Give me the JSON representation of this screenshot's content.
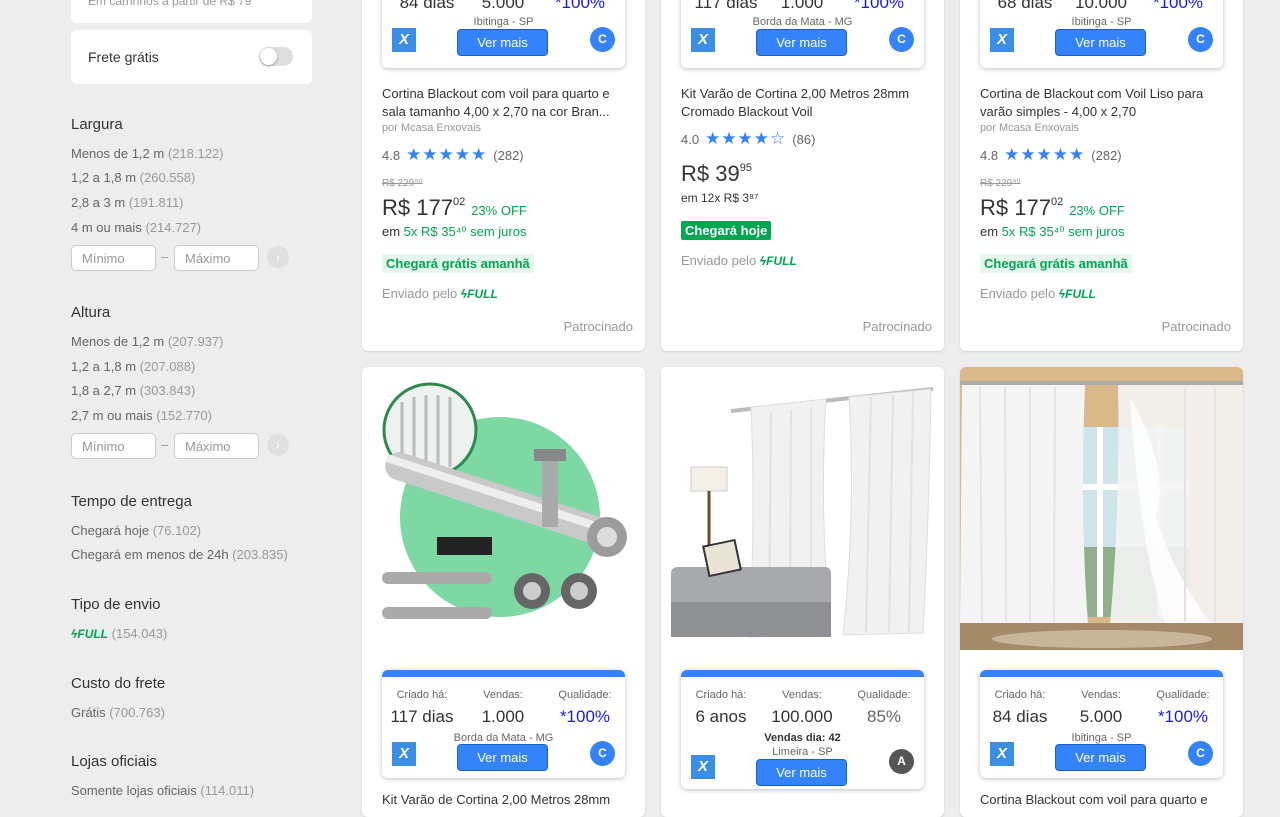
{
  "filters": {
    "shipping_note": "Em carrinhos a partir de R$ 79",
    "free_shipping_label": "Frete grátis",
    "min_placeholder": "Mínimo",
    "max_placeholder": "Máximo",
    "width": {
      "title": "Largura",
      "items": [
        {
          "label": "Menos de 1,2 m",
          "count": "(218.122)"
        },
        {
          "label": "1,2 a 1,8 m",
          "count": "(260.558)"
        },
        {
          "label": "2,8 a 3 m",
          "count": "(191.811)"
        },
        {
          "label": "4 m ou mais",
          "count": "(214.727)"
        }
      ]
    },
    "height": {
      "title": "Altura",
      "items": [
        {
          "label": "Menos de 1,2 m",
          "count": "(207.937)"
        },
        {
          "label": "1,2 a 1,8 m",
          "count": "(207.088)"
        },
        {
          "label": "1,8 a 2,7 m",
          "count": "(303.843)"
        },
        {
          "label": "2,7 m ou mais",
          "count": "(152.770)"
        }
      ]
    },
    "delivery": {
      "title": "Tempo de entrega",
      "items": [
        {
          "label": "Chegará hoje",
          "count": "(76.102)"
        },
        {
          "label": "Chegará em menos de 24h",
          "count": "(203.835)"
        }
      ]
    },
    "shipping_type": {
      "title": "Tipo de envio",
      "full": "FULL",
      "count": "(154.043)"
    },
    "shipping_cost": {
      "title": "Custo do frete",
      "label": "Grátis",
      "count": "(700.763)"
    },
    "official": {
      "title": "Lojas oficiais",
      "label": "Somente lojas oficiais",
      "count": "(114.011)"
    }
  },
  "widget_labels": {
    "created": "Criado há:",
    "sales": "Vendas:",
    "quality": "Qualidade:",
    "more": "Ver mais",
    "logo": "X",
    "sales_day": "Vendas dia: 42"
  },
  "top_cards": [
    {
      "created": "84 dias",
      "sales": "5.000",
      "quality": "*100%",
      "location": "Ibitinga - SP",
      "badge": "C",
      "title": "Cortina Blackout com voil para quarto e sala tamanho 4,00 x 2,70 na cor Bran...",
      "seller": "por Mcasa Enxovais",
      "rating": "4.8",
      "stars": "★★★★★",
      "reviews": "(282)",
      "old_price": "R$ 229⁹⁰",
      "price_int": "R$ 177",
      "price_cents": "02",
      "discount": "23% OFF",
      "inst_prefix": "em ",
      "inst": "5x R$ 35⁴⁰ sem juros",
      "delivery": "Chegará grátis amanhã",
      "sent": "Enviado pelo",
      "full": "FULL",
      "sponsored": "Patrocinado"
    },
    {
      "created": "117 dias",
      "sales": "1.000",
      "quality": "*100%",
      "location": "Borda da Mata - MG",
      "badge": "C",
      "title": "Kit Varão de Cortina 2,00 Metros 28mm Cromado Blackout Voil",
      "seller": "",
      "rating": "4.0",
      "stars": "★★★★☆",
      "reviews": "(86)",
      "price_int": "R$ 39",
      "price_cents": "95",
      "inst": "em 12x R$ 3⁸⁷",
      "delivery": "Chegará hoje",
      "sent": "Enviado pelo",
      "full": "FULL",
      "sponsored": "Patrocinado"
    },
    {
      "created": "68 dias",
      "sales": "10.000",
      "quality": "*100%",
      "location": "Ibitinga - SP",
      "badge": "C",
      "title": "Cortina de Blackout com Voil Liso para varão simples - 4,00 x 2,70",
      "seller": "por Mcasa Enxovais",
      "rating": "4.8",
      "stars": "★★★★★",
      "reviews": "(282)",
      "old_price": "R$ 229⁹⁰",
      "price_int": "R$ 177",
      "price_cents": "02",
      "discount": "23% OFF",
      "inst_prefix": "em ",
      "inst": "5x R$ 35⁴⁰ sem juros",
      "delivery": "Chegará grátis amanhã",
      "sent": "Enviado pelo",
      "full": "FULL",
      "sponsored": "Patrocinado"
    }
  ],
  "bottom_cards": [
    {
      "created": "117 dias",
      "sales": "1.000",
      "quality": "*100%",
      "location": "Borda da Mata - MG",
      "badge": "C",
      "title": "Kit Varão de Cortina 2,00 Metros 28mm"
    },
    {
      "created": "6 anos",
      "sales": "100.000",
      "quality": "85%",
      "location": "Limeira - SP",
      "badge": "A"
    },
    {
      "created": "84 dias",
      "sales": "5.000",
      "quality": "*100%",
      "location": "Ibitinga - SP",
      "badge": "C",
      "title": "Cortina Blackout com voil para quarto e"
    }
  ]
}
